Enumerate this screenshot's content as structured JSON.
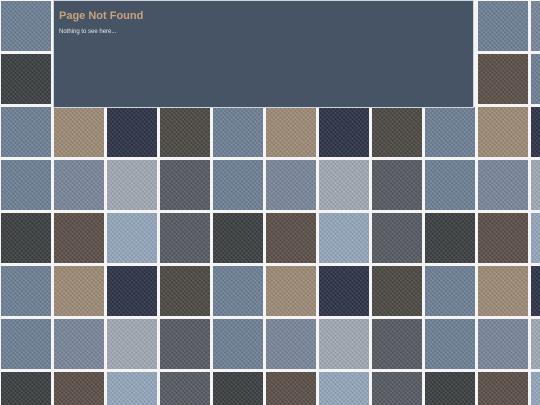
{
  "error": {
    "title": "Page Not Found",
    "message": "Nothing to see here..."
  },
  "background": {
    "pattern": "denim-fabric-tiles",
    "colors": {
      "light_blue_denim": "#6f8197",
      "dark_charcoal": "#3b3e40",
      "tan_khaki": "#a08c78",
      "navy": "#2c3147",
      "dark_brown_gray": "#4c4843",
      "warm_brown": "#5c4f48",
      "pale_blue": "#97a9bf",
      "light_gray_blue": "#a3abb6",
      "slate": "#565b62",
      "mid_denim": "#7a889b"
    },
    "rows": [
      [
        "light_blue_denim",
        "",
        "",
        "",
        "",
        "",
        "",
        "",
        "",
        "light_blue_denim",
        "mid_denim"
      ],
      [
        "dark_charcoal",
        "",
        "",
        "",
        "",
        "",
        "",
        "",
        "",
        "warm_brown",
        "light_blue_denim"
      ],
      [
        "light_blue_denim",
        "tan_khaki",
        "navy",
        "dark_brown_gray",
        "light_blue_denim",
        "tan_khaki",
        "navy",
        "dark_brown_gray",
        "light_blue_denim",
        "tan_khaki",
        "navy"
      ],
      [
        "light_blue_denim",
        "mid_denim",
        "light_gray_blue",
        "slate",
        "light_blue_denim",
        "mid_denim",
        "light_gray_blue",
        "slate",
        "light_blue_denim",
        "mid_denim",
        "light_gray_blue"
      ],
      [
        "dark_charcoal",
        "warm_brown",
        "pale_blue",
        "slate",
        "dark_charcoal",
        "warm_brown",
        "pale_blue",
        "slate",
        "dark_charcoal",
        "warm_brown",
        "pale_blue"
      ],
      [
        "light_blue_denim",
        "tan_khaki",
        "navy",
        "dark_brown_gray",
        "light_blue_denim",
        "tan_khaki",
        "navy",
        "dark_brown_gray",
        "light_blue_denim",
        "tan_khaki",
        "navy"
      ],
      [
        "light_blue_denim",
        "mid_denim",
        "light_gray_blue",
        "slate",
        "light_blue_denim",
        "mid_denim",
        "light_gray_blue",
        "slate",
        "light_blue_denim",
        "mid_denim",
        "light_gray_blue"
      ],
      [
        "dark_charcoal",
        "warm_brown",
        "pale_blue",
        "slate",
        "dark_charcoal",
        "warm_brown",
        "pale_blue",
        "slate",
        "dark_charcoal",
        "warm_brown",
        "pale_blue"
      ]
    ]
  }
}
